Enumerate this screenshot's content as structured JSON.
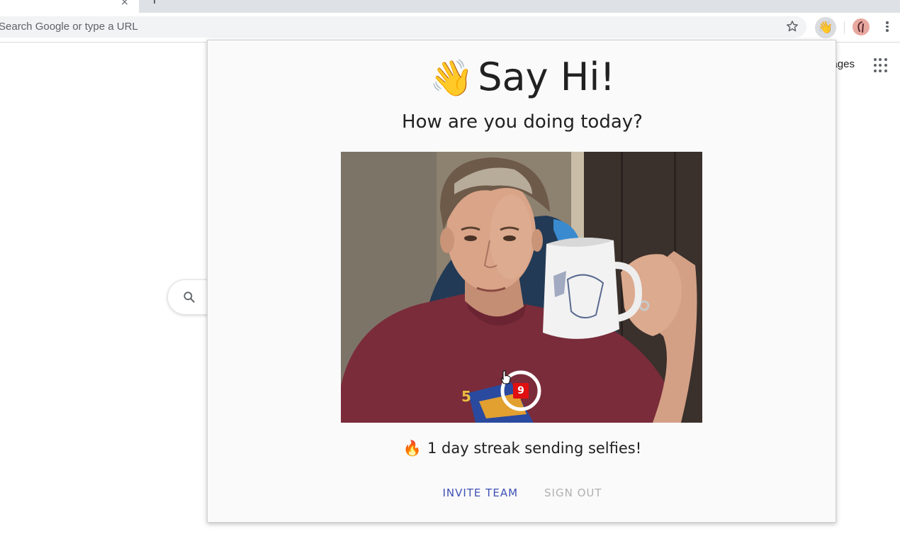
{
  "browser": {
    "tab_close": "×",
    "omnibox_placeholder": "Search Google or type a URL",
    "extension_emoji": "👋",
    "star_icon": "star-outline-icon",
    "menu_icon": "three-dots-vertical-icon"
  },
  "google_page": {
    "images_link": "Images",
    "apps_icon": "apps-grid-icon",
    "search_icon": "magnifier-icon"
  },
  "popup": {
    "wave_emoji": "👋",
    "headline": "Say Hi!",
    "subtitle": "How are you doing today?",
    "countdown": "9",
    "streak_emoji": "🔥",
    "streak_text": "1 day streak sending selfies!",
    "invite_label": "INVITE TEAM",
    "signout_label": "SIGN OUT",
    "colors": {
      "accent": "#3f51b5",
      "disabled": "#b0b0b0",
      "countdown_bg": "#e01010"
    }
  }
}
